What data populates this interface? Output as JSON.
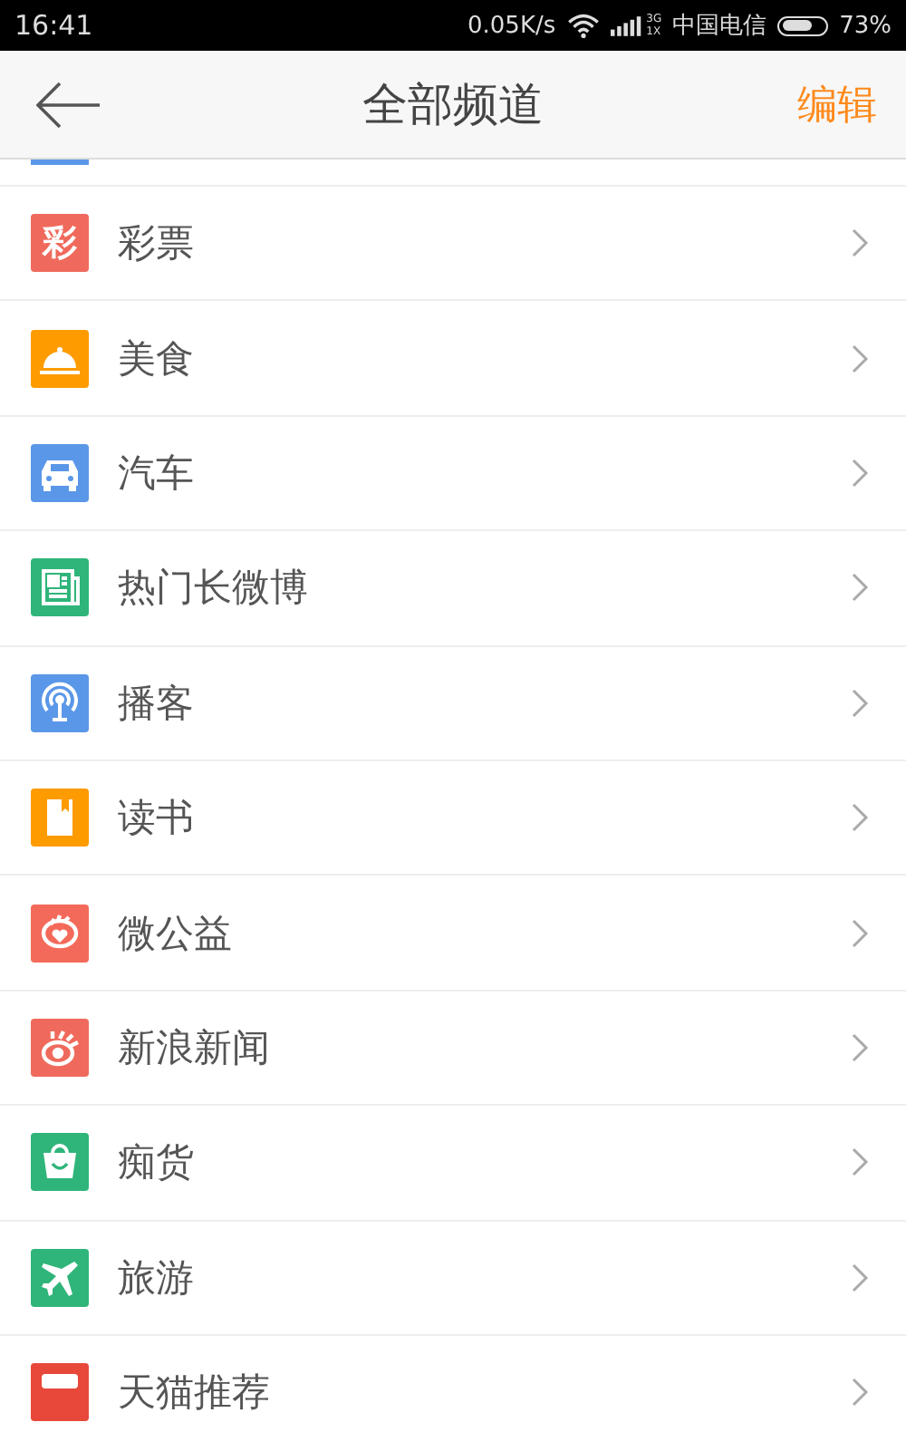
{
  "status_bar": {
    "time": "16:41",
    "speed": "0.05K/s",
    "network_top": "3G",
    "network_bottom": "1X",
    "carrier": "中国电信",
    "battery": "73%",
    "battery_meter": {
      "level": 0.73
    }
  },
  "header": {
    "back": true,
    "title": "全部频道",
    "action": "编辑"
  },
  "previous_row": {
    "color": "#5b97e8"
  },
  "channels": [
    {
      "label": "彩票",
      "kind": "glyph",
      "icon_text": "彩",
      "color": "#ef6a5c"
    },
    {
      "label": "美食",
      "kind": "cloche",
      "color": "#fe9b00"
    },
    {
      "label": "汽车",
      "kind": "car",
      "color": "#5b97e8"
    },
    {
      "label": "热门长微博",
      "kind": "newspaper",
      "color": "#2fb57a"
    },
    {
      "label": "播客",
      "kind": "podcast",
      "color": "#5b97e8"
    },
    {
      "label": "读书",
      "kind": "book",
      "color": "#fe9b00"
    },
    {
      "label": "微公益",
      "kind": "heart",
      "color": "#f46a5a"
    },
    {
      "label": "新浪新闻",
      "kind": "eye",
      "color": "#ef6a5c"
    },
    {
      "label": "痴货",
      "kind": "bag",
      "color": "#2fb57a"
    },
    {
      "label": "旅游",
      "kind": "plane",
      "color": "#2fb57a"
    },
    {
      "label": "天猫推荐",
      "kind": "cat",
      "color": "#e8483a"
    }
  ]
}
